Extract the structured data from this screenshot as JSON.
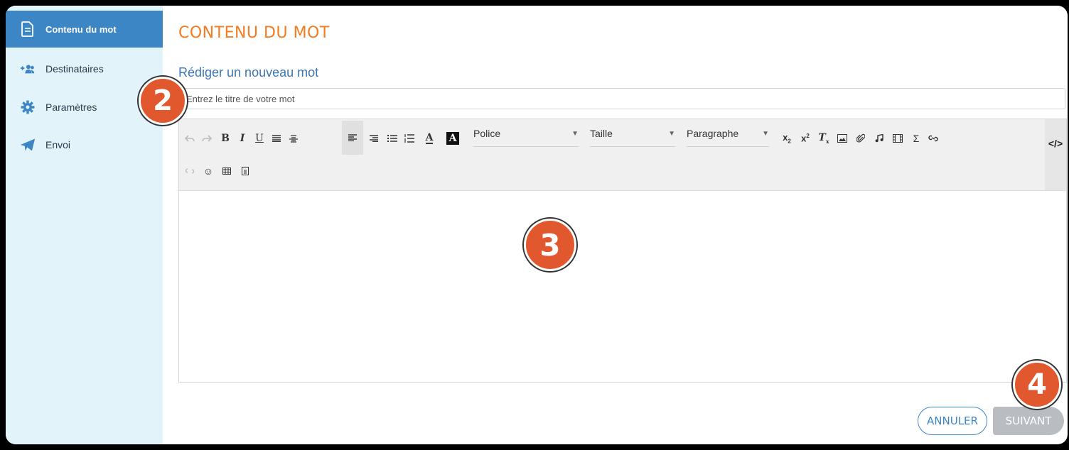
{
  "sidebar": {
    "items": [
      {
        "label": "Contenu du mot",
        "icon": "document-icon",
        "active": true
      },
      {
        "label": "Destinataires",
        "icon": "add-users-icon",
        "active": false
      },
      {
        "label": "Paramètres",
        "icon": "gear-icon",
        "active": false
      },
      {
        "label": "Envoi",
        "icon": "paper-plane-icon",
        "active": false
      }
    ]
  },
  "main": {
    "title": "CONTENU DU MOT",
    "subtitle": "Rédiger un nouveau mot",
    "title_input": {
      "placeholder": "Entrez le titre de votre mot",
      "value": ""
    }
  },
  "toolbar": {
    "font_select": "Police",
    "size_select": "Taille",
    "format_select": "Paragraphe"
  },
  "badges": {
    "b2": "2",
    "b3": "3",
    "b4": "4"
  },
  "buttons": {
    "cancel": "ANNULER",
    "next": "SUIVANT"
  },
  "colors": {
    "accent": "#3d86c6",
    "title_orange": "#f47b20",
    "badge_orange": "#e2582e",
    "sidebar_bg": "#e2f3fa"
  }
}
